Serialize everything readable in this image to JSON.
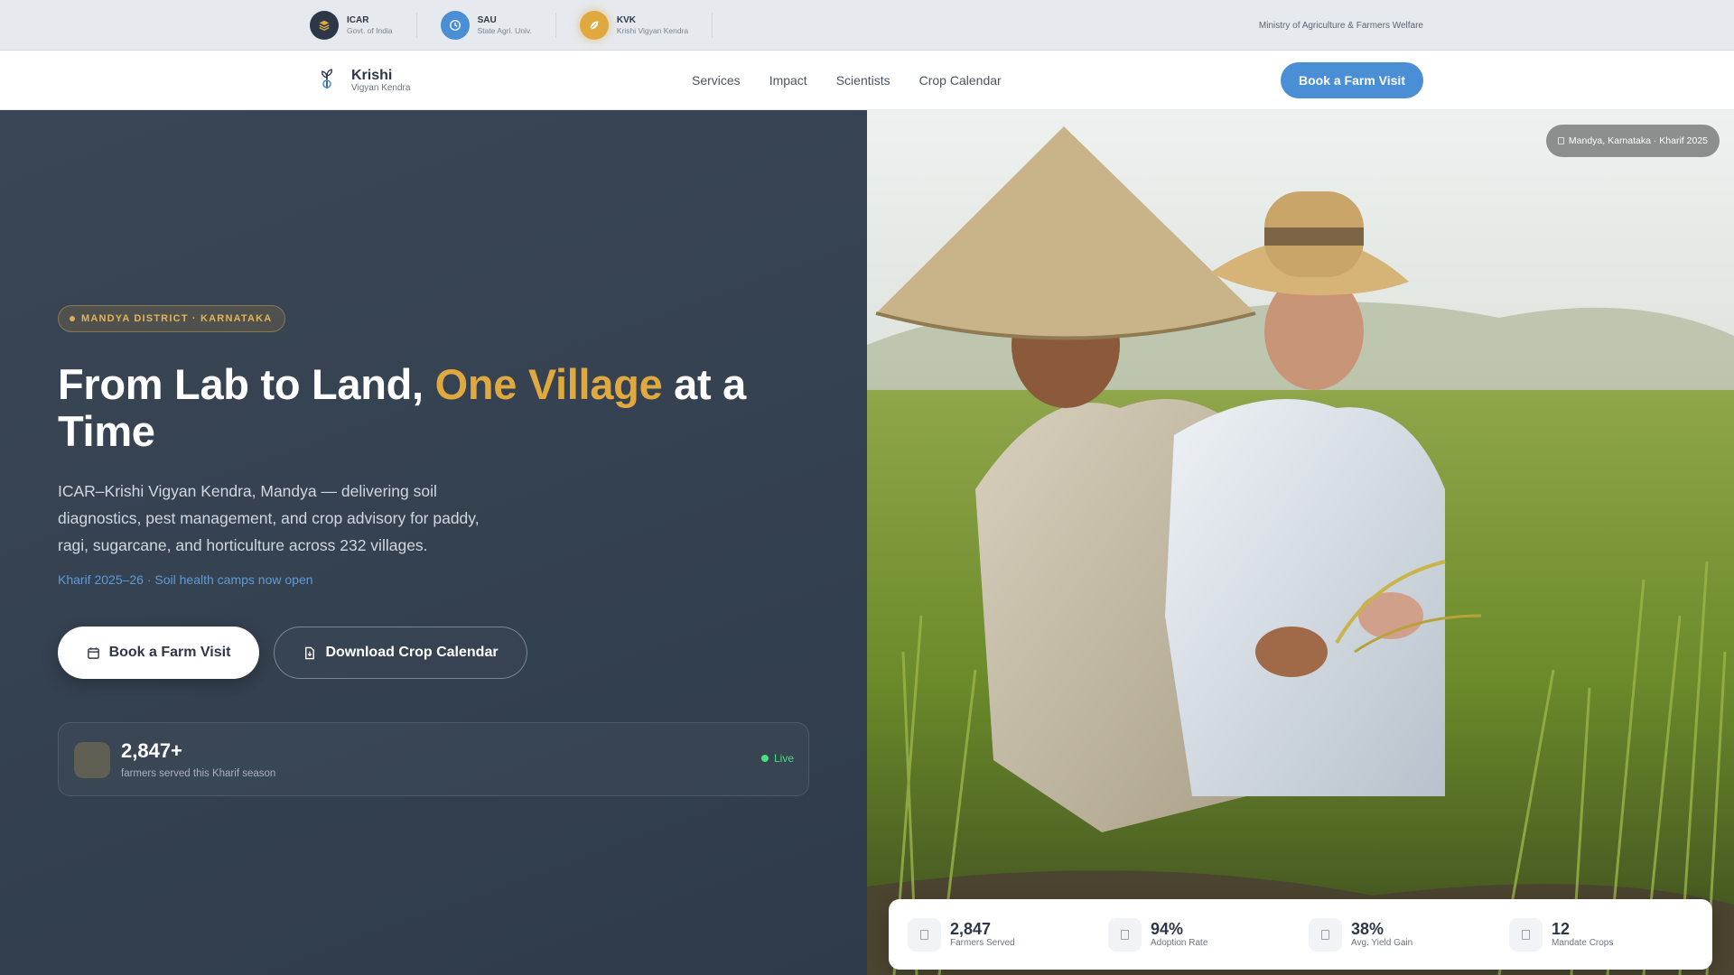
{
  "topbar": {
    "orgs": [
      {
        "name": "ICAR",
        "sub": "Govt. of India",
        "color": "#2d3748",
        "icon": "layers-icon"
      },
      {
        "name": "SAU",
        "sub": "State Agri. Univ.",
        "color": "#4a8fd6",
        "icon": "clock-icon"
      },
      {
        "name": "KVK",
        "sub": "Krishi Vigyan Kendra",
        "color": "#e0a93f",
        "icon": "leaf-icon"
      }
    ],
    "ministry": "Ministry of Agriculture & Farmers Welfare"
  },
  "nav": {
    "brand_name": "Krishi",
    "brand_sub": "Vigyan Kendra",
    "links": [
      "Services",
      "Impact",
      "Scientists",
      "Crop Calendar"
    ],
    "cta": "Book a Farm Visit"
  },
  "hero": {
    "badge": "MANDYA DISTRICT · KARNATAKA",
    "title_part1": "From Lab to Land, ",
    "title_accent": "One Village",
    "title_part2": " at a Time",
    "description": "ICAR–Krishi Vigyan Kendra, Mandya — delivering soil diagnostics, pest management, and crop advisory for paddy, ragi, sugarcane, and horticulture across 232 villages.",
    "note": "Kharif 2025–26 · Soil health camps now open",
    "primary_button": "Book a Farm Visit",
    "secondary_button": "Download Crop Calendar",
    "live_card": {
      "count": "2,847+",
      "label": "farmers served this Kharif season",
      "status": "Live"
    }
  },
  "photo": {
    "location": "Mandya, Karnataka · Kharif 2025"
  },
  "stats": [
    {
      "value": "2,847",
      "label": "Farmers Served"
    },
    {
      "value": "94%",
      "label": "Adoption Rate"
    },
    {
      "value": "38%",
      "label": "Avg. Yield Gain"
    },
    {
      "value": "12",
      "label": "Mandate Crops"
    }
  ],
  "colors": {
    "accent_gold": "#e0a93f",
    "primary_blue": "#4a8fd6",
    "hero_dark": "#354251",
    "live_green": "#4ade80"
  }
}
